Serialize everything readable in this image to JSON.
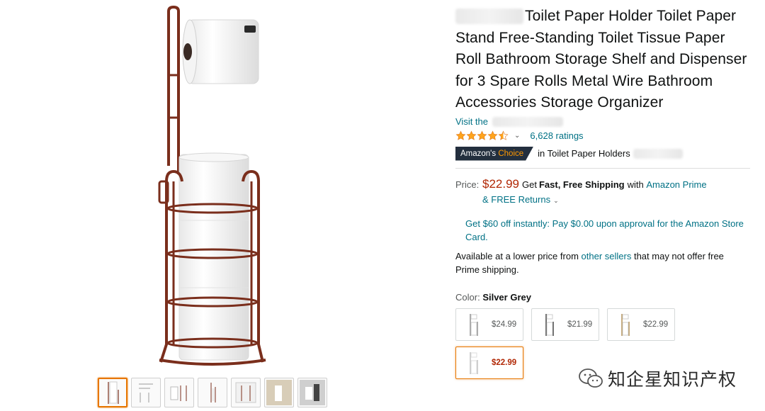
{
  "product": {
    "title": "Toilet Paper Holder Toilet Paper Stand Free-Standing Toilet Tissue Paper Roll Bathroom Storage Shelf and Dispenser for 3 Spare Rolls Metal Wire Bathroom Accessories Storage Organizer",
    "visit_label": "Visit the",
    "rating_stars": 4.5,
    "ratings_count": "6,628 ratings",
    "badge_prefix": "Amazon's",
    "badge_suffix": "Choice",
    "choice_category": "in Toilet Paper Holders"
  },
  "price": {
    "label": "Price:",
    "amount": "$22.99",
    "get": "Get",
    "shipping_bold": "Fast, Free Shipping",
    "with": "with",
    "prime": "Amazon Prime",
    "returns": "& FREE Returns"
  },
  "offer_text": "Get $60 off instantly: Pay $0.00 upon approval for the Amazon Store Card.",
  "lower_price": {
    "prefix": "Available at a lower price from",
    "link": "other sellers",
    "suffix": "that may not offer free Prime shipping."
  },
  "color": {
    "label": "Color:",
    "value": "Silver Grey"
  },
  "swatches": [
    {
      "price": "$24.99"
    },
    {
      "price": "$21.99"
    },
    {
      "price": "$22.99"
    },
    {
      "price": "$22.99"
    }
  ],
  "watermark": "知企星知识产权",
  "colors": {
    "link": "#007185",
    "price_red": "#b12704",
    "selection_orange": "#e77600",
    "badge_navy": "#232f3e",
    "star_orange": "#ffa41c",
    "bronze": "#7a2e1c"
  }
}
